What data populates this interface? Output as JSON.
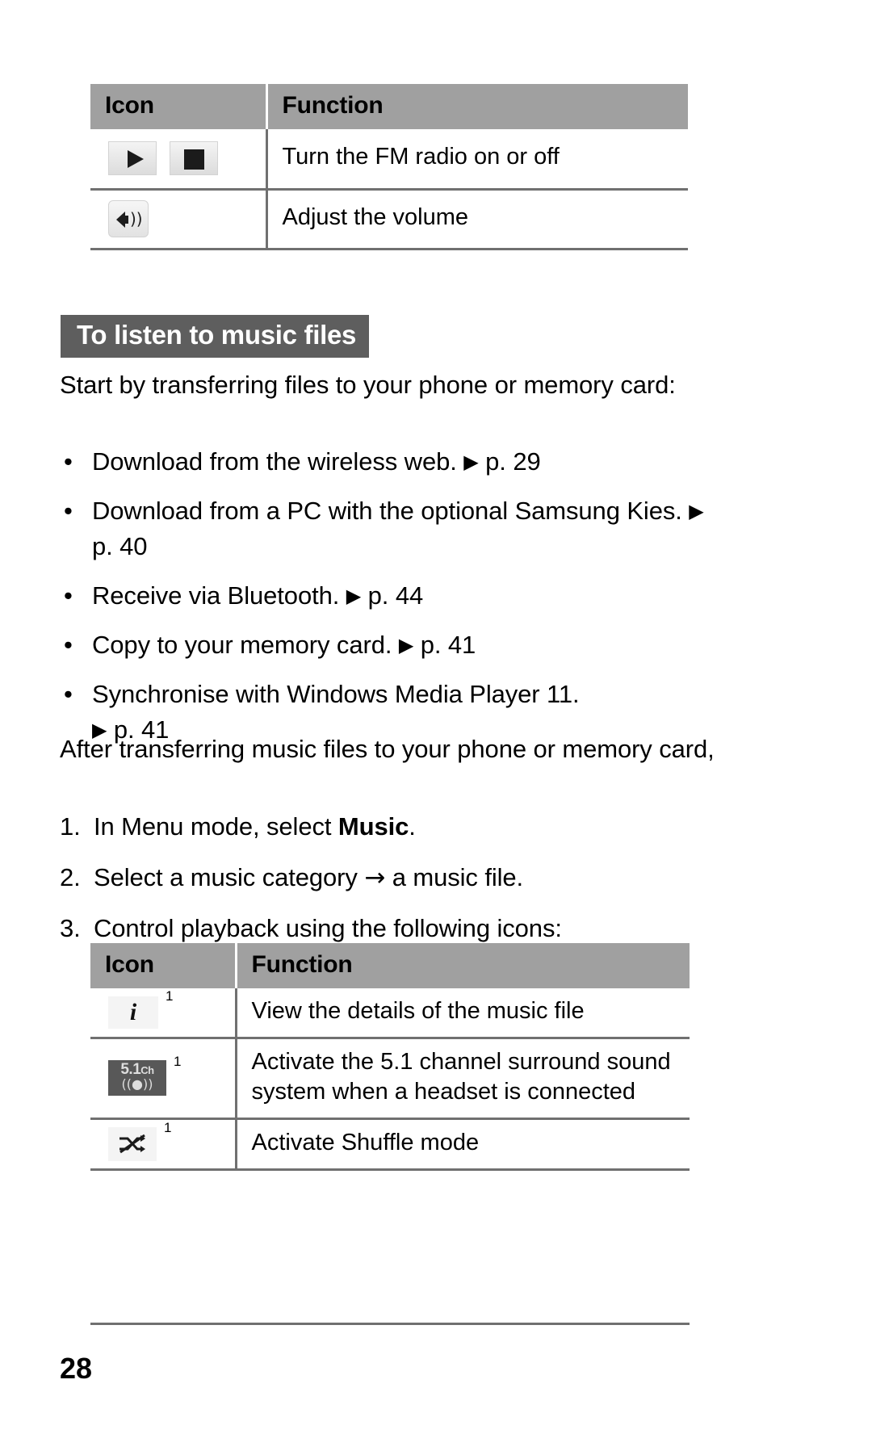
{
  "document": {
    "page_number": "28"
  },
  "table_one": {
    "headers": {
      "icon": "Icon",
      "function": "Function"
    },
    "rows": [
      {
        "icons": [
          "play-icon",
          "stop-icon"
        ],
        "function": "Turn the FM radio on or off"
      },
      {
        "icons": [
          "volume-icon"
        ],
        "function": "Adjust the volume"
      }
    ]
  },
  "section": {
    "heading": "To listen to music files",
    "intro": "Start by transferring files to your phone or memory card:",
    "bullets": [
      {
        "text": "Download from the wireless web.",
        "ref": "p. 29"
      },
      {
        "text": "Download from a PC with the optional Samsung Kies.",
        "ref": "p. 40"
      },
      {
        "text": "Receive via Bluetooth.",
        "ref": "p. 44"
      },
      {
        "text": "Copy to your memory card.",
        "ref": "p. 41"
      },
      {
        "text": "Synchronise with Windows Media Player 11.",
        "ref": "p. 41"
      }
    ],
    "after_paragraph": "After transferring music files to your phone or memory card,",
    "steps": [
      {
        "number": "1.",
        "before": "In Menu mode, select ",
        "bold": "Music",
        "after": "."
      },
      {
        "number": "2.",
        "before": "Select a music category ",
        "arrow": "→",
        "after": " a music file."
      },
      {
        "number": "3.",
        "before": "Control playback using the following icons:",
        "bold": "",
        "after": ""
      }
    ]
  },
  "table_two": {
    "headers": {
      "icon": "Icon",
      "function": "Function"
    },
    "rows": [
      {
        "icon": "info-icon",
        "superscript": "1",
        "function": "View the details of the music file"
      },
      {
        "icon": "5-1-channel-icon",
        "superscript": "1",
        "icon_label_main": "5.1",
        "icon_label_sub": "Ch",
        "icon_label_wave": "((●))",
        "function": "Activate the 5.1 channel surround sound system when a headset is connected"
      },
      {
        "icon": "shuffle-icon",
        "superscript": "1",
        "function": "Activate Shuffle mode"
      }
    ]
  },
  "glyphs": {
    "bullet": "•",
    "triangle": "▶",
    "info_letter": "i",
    "volume_waves": "))"
  },
  "colors": {
    "table_header_bg": "#a0a0a0",
    "heading_bg": "#5e5e5e",
    "rule": "#707070",
    "icon_dark": "#585858"
  }
}
